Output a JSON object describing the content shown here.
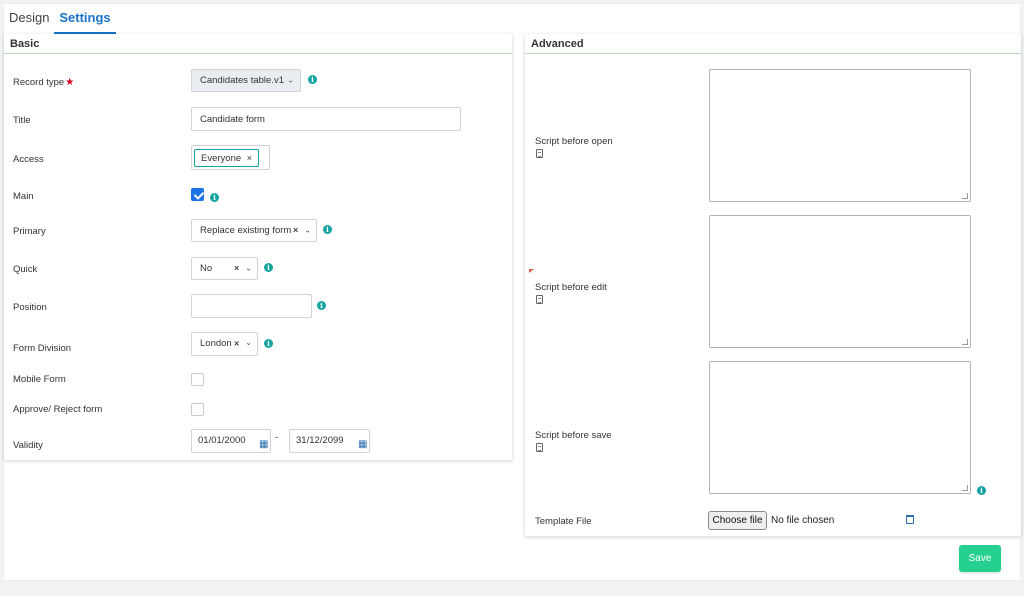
{
  "tabs": [
    {
      "label": "Design",
      "active": false
    },
    {
      "label": "Settings",
      "active": true
    }
  ],
  "basic": {
    "title": "Basic",
    "record_type": {
      "label": "Record type",
      "required_mark": "★",
      "value": "Candidates table.v1"
    },
    "title_field": {
      "label": "Title",
      "value": "Candidate form"
    },
    "access": {
      "label": "Access",
      "tags": [
        "Everyone"
      ]
    },
    "main": {
      "label": "Main",
      "checked": true
    },
    "primary": {
      "label": "Primary",
      "value": "Replace existing form"
    },
    "quick": {
      "label": "Quick",
      "value": "No"
    },
    "position": {
      "label": "Position",
      "value": ""
    },
    "form_division": {
      "label": "Form Division",
      "value": "London"
    },
    "mobile_form": {
      "label": "Mobile Form",
      "checked": false
    },
    "approve_reject": {
      "label": "Approve/ Reject form",
      "checked": false
    },
    "validity": {
      "label": "Validity",
      "from": "01/01/2000",
      "separator": "-",
      "to": "31/12/2099"
    }
  },
  "advanced": {
    "title": "Advanced",
    "script_before_open": {
      "label": "Script before open",
      "value": ""
    },
    "script_before_edit": {
      "label": "Script before edit",
      "value": ""
    },
    "script_before_save": {
      "label": "Script before save",
      "value": ""
    },
    "template_file": {
      "label": "Template File",
      "button": "Choose file",
      "status": "No file chosen"
    }
  },
  "actions": {
    "save": "Save"
  },
  "colors": {
    "accent": "#1a73c9",
    "info": "#13a3a0",
    "save": "#26d08f",
    "section_rule": "#b9ddb8"
  },
  "icons": {
    "info": "info-icon",
    "calendar": "calendar-icon",
    "script": "document-icon",
    "delete": "trash-icon"
  }
}
